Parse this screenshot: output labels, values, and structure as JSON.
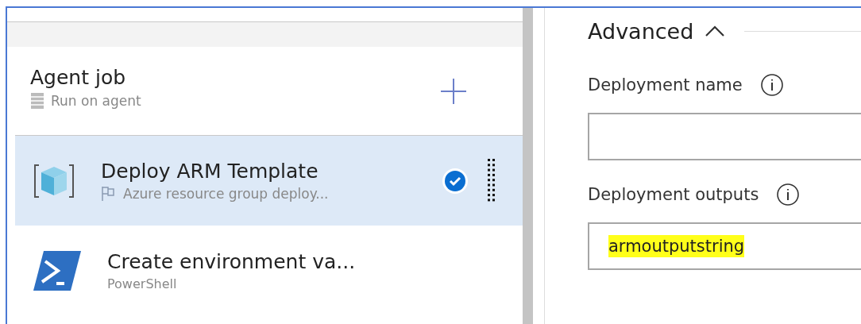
{
  "job": {
    "title": "Agent job",
    "subtitle": "Run on agent"
  },
  "tasks": [
    {
      "kind": "arm",
      "title": "Deploy ARM Template",
      "subtitle": "Azure resource group deploy...",
      "selected": true,
      "enabled": true
    },
    {
      "kind": "powershell",
      "title": "Create environment va...",
      "subtitle": "PowerShell",
      "selected": false,
      "enabled": false
    }
  ],
  "section": {
    "title": "Advanced",
    "expanded": true
  },
  "fields": [
    {
      "label": "Deployment name"
    },
    {
      "label": "Deployment outputs",
      "value": "armoutputstring",
      "highlighted": true
    }
  ]
}
